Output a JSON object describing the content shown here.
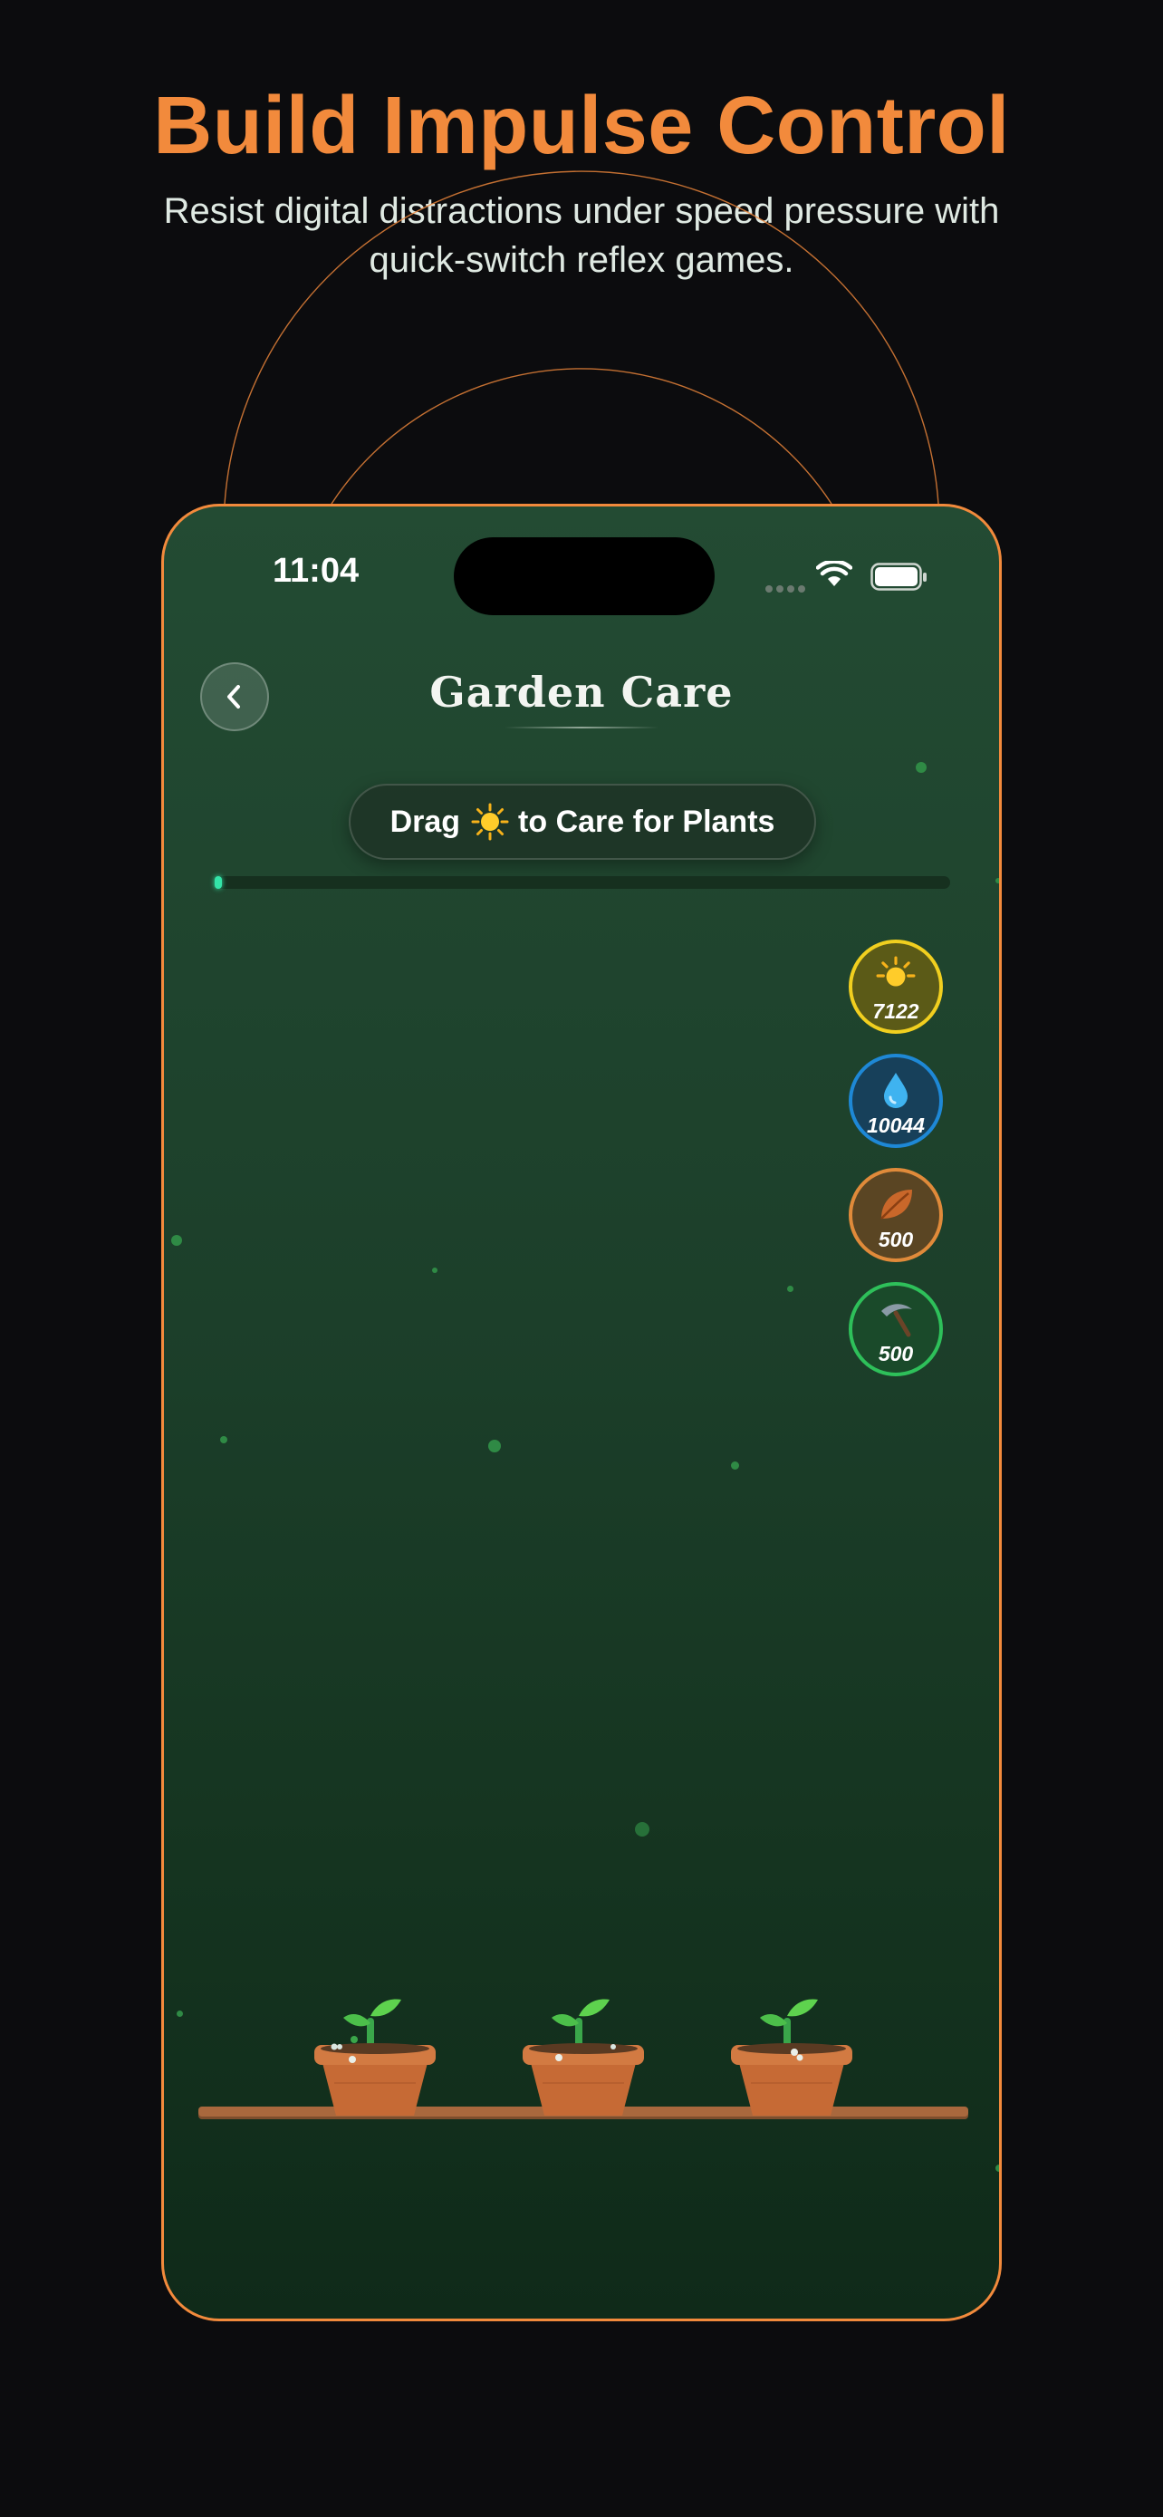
{
  "hero": {
    "title": "Build Impulse Control",
    "subtitle": "Resist digital distractions under speed pressure with quick-switch reflex games."
  },
  "colors": {
    "accent": "#f28a3c",
    "sun": "#f1cf1f",
    "water": "#1e88d6",
    "leaf": "#e08a3a",
    "tool": "#2ec05a",
    "progress": "#34e4a8"
  },
  "status_bar": {
    "time": "11:04"
  },
  "screen": {
    "title": "Garden Care",
    "back_icon": "chevron-left-icon",
    "instruction": {
      "prefix": "Drag",
      "icon": "sun-icon",
      "suffix": "to Care for Plants"
    },
    "progress": 0.01
  },
  "resources": [
    {
      "name": "sun",
      "icon": "sun-icon",
      "value": "7122"
    },
    {
      "name": "water",
      "icon": "water-drop-icon",
      "value": "10044"
    },
    {
      "name": "fertilizer",
      "icon": "leaf-icon",
      "value": "500"
    },
    {
      "name": "tool",
      "icon": "pickaxe-icon",
      "value": "500"
    }
  ],
  "pots": [
    {
      "name": "pot-1",
      "icon": "sprout-icon"
    },
    {
      "name": "pot-2",
      "icon": "sprout-icon"
    },
    {
      "name": "pot-3",
      "icon": "sprout-icon"
    }
  ]
}
